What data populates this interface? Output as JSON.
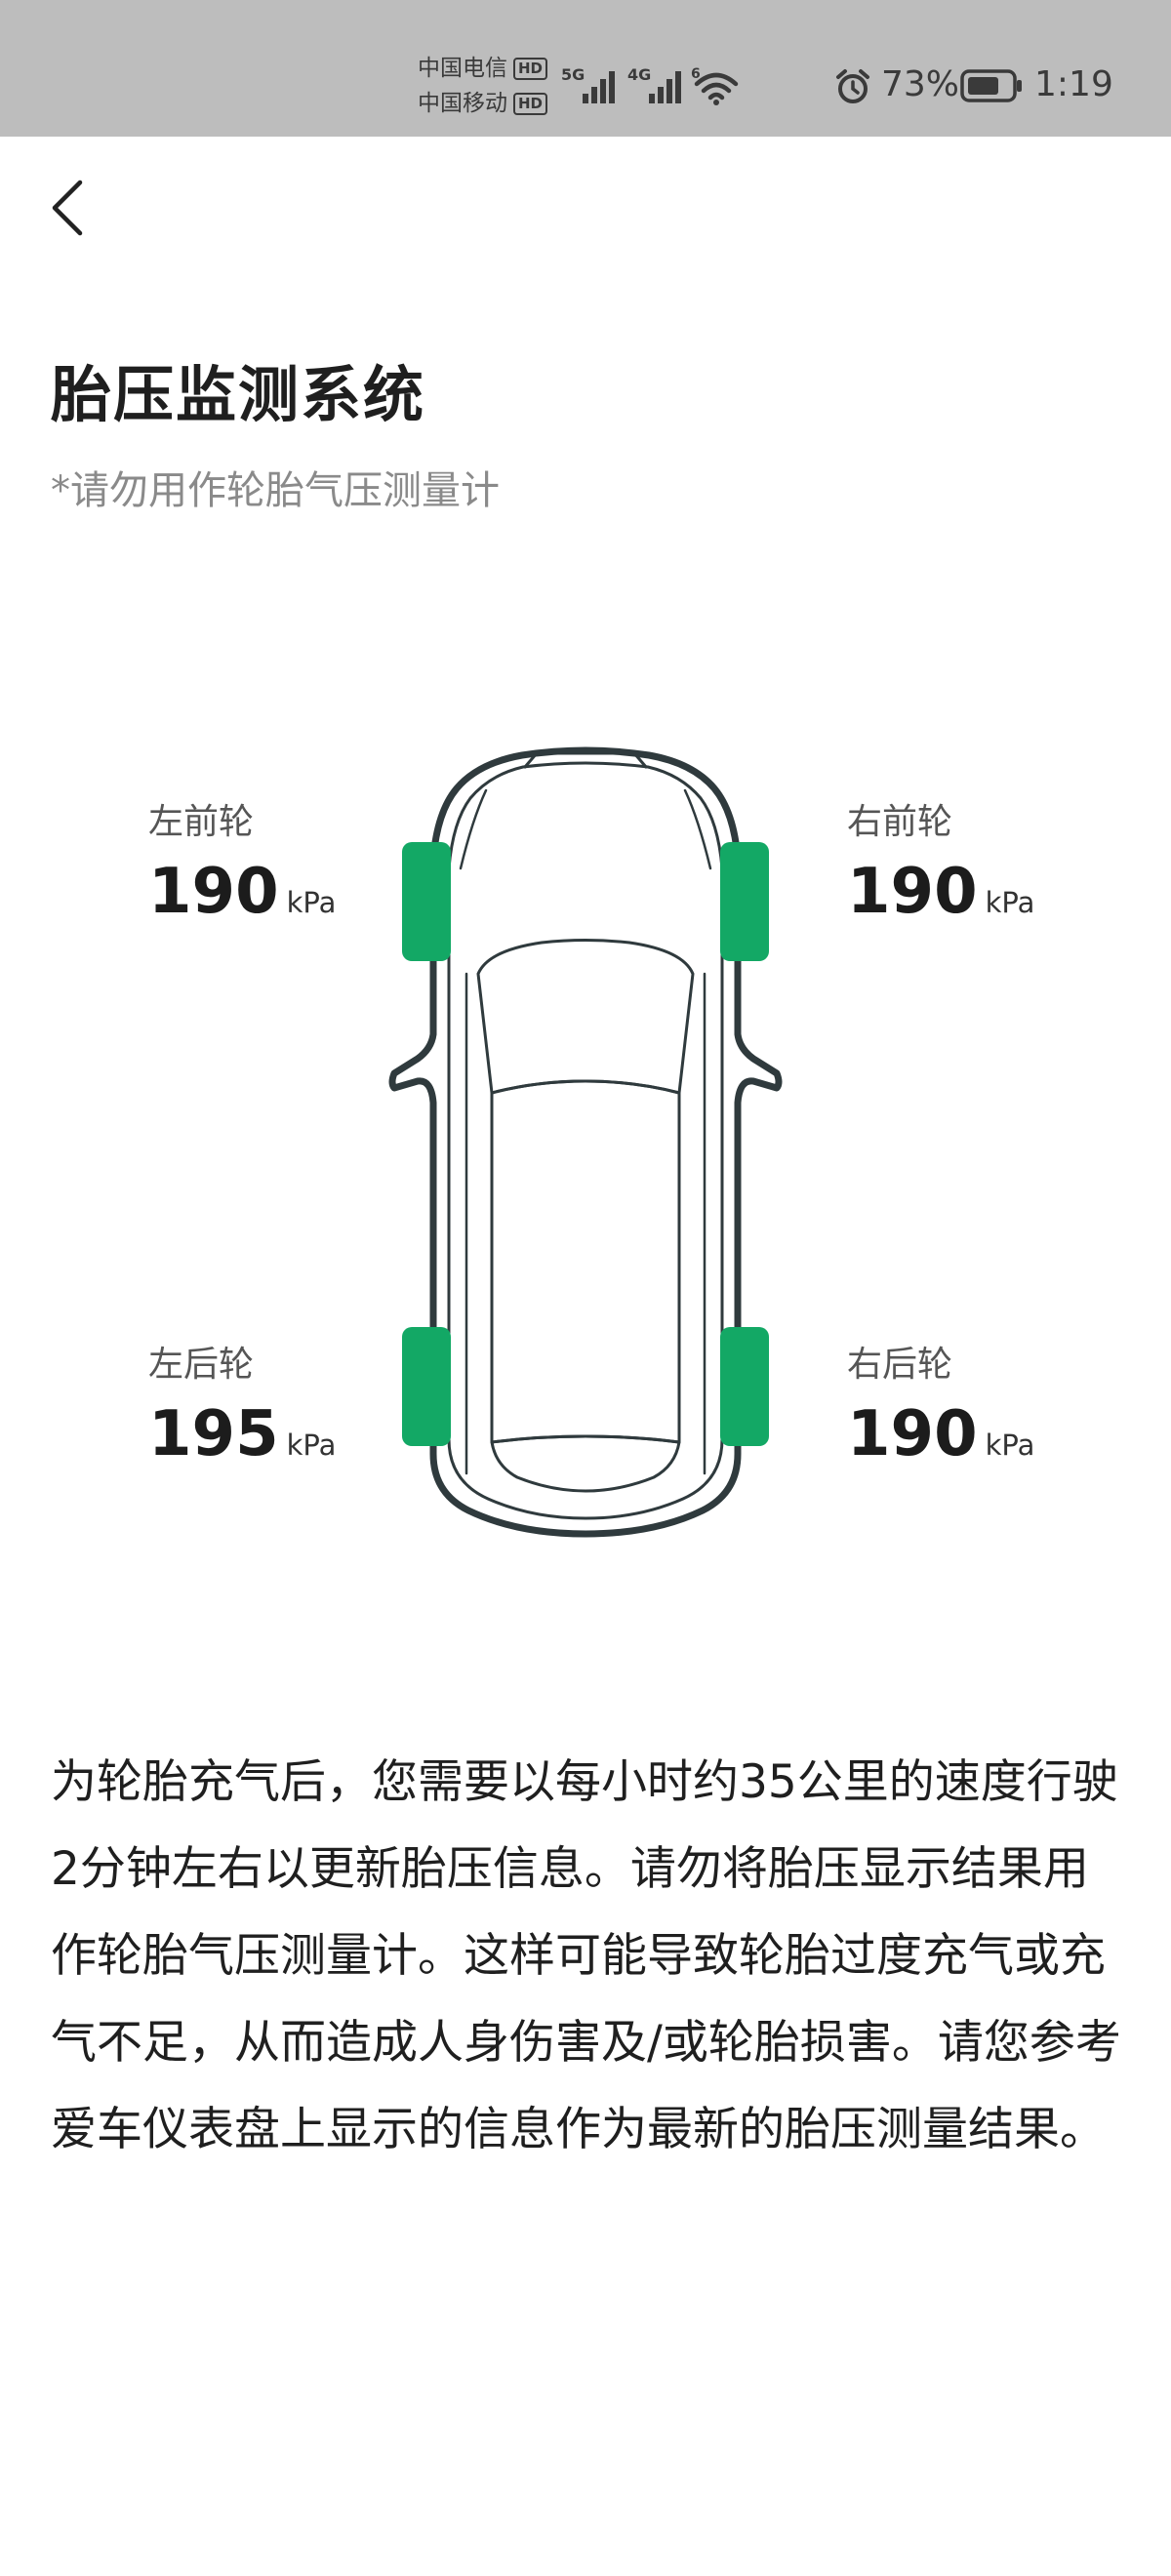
{
  "status_bar": {
    "carrier1": "中国电信",
    "carrier2": "中国移动",
    "hd_badge": "HD",
    "net1": "5G",
    "net2": "4G",
    "wifi_tag": "6",
    "battery_percent": "73%",
    "time": "1:19",
    "battery_level": 0.73,
    "icons": [
      "signal-icon",
      "wifi-icon",
      "alarm-icon",
      "battery-icon"
    ]
  },
  "header": {
    "back_icon": "chevron-left-icon",
    "title": "胎压监测系统",
    "subtitle": "*请勿用作轮胎气压测量计"
  },
  "tires": {
    "front_left": {
      "label": "左前轮",
      "value": "190",
      "unit": "kPa"
    },
    "front_right": {
      "label": "右前轮",
      "value": "190",
      "unit": "kPa"
    },
    "rear_left": {
      "label": "左后轮",
      "value": "195",
      "unit": "kPa"
    },
    "rear_right": {
      "label": "右后轮",
      "value": "190",
      "unit": "kPa"
    }
  },
  "colors": {
    "tire_ok": "#13a865",
    "car_outline": "#2f3a3d",
    "status_bar_bg": "#bdbdbd"
  },
  "description": "为轮胎充气后，您需要以每小时约35公里的速度行驶2分钟左右以更新胎压信息。请勿将胎压显示结果用作轮胎气压测量计。这样可能导致轮胎过度充气或充气不足，从而造成人身伤害及/或轮胎损害。请您参考爱车仪表盘上显示的信息作为最新的胎压测量结果。"
}
